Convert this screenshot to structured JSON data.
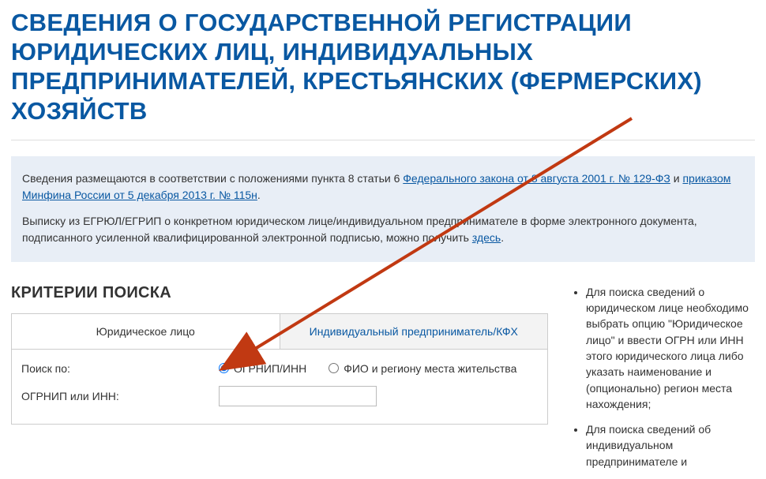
{
  "title": "Сведения о государственной регистрации юридических лиц, индивидуальных предпринимателей, крестьянских (фермерских) хозяйств",
  "info": {
    "p1_prefix": "Сведения размещаются в соответствии с положениями пункта 8 статьи 6 ",
    "link1": "Федерального закона от 8 августа 2001 г. № 129-ФЗ",
    "p1_mid": " и ",
    "link2": "приказом Минфина России от 5 декабря 2013 г. № 115н",
    "p1_suffix": ".",
    "p2_prefix": "Выписку из ЕГРЮЛ/ЕГРИП о конкретном юридическом лице/индивидуальном предпринимателе в форме электронного документа, подписанного усиленной квалифицированной электронной подписью, можно получить ",
    "link3": "здесь",
    "p2_suffix": "."
  },
  "criteria_heading": "Критерии поиска",
  "tabs": {
    "legal": "Юридическое лицо",
    "individual": "Индивидуальный предприниматель/КФХ"
  },
  "form": {
    "search_by_label": "Поиск по:",
    "radio1": "ОГРНИП/ИНН",
    "radio2": "ФИО и региону места жительства",
    "ogrn_label": "ОГРНИП или ИНН:",
    "ogrn_value": ""
  },
  "help": {
    "li1": "Для поиска сведений о юридическом лице необходимо выбрать опцию \"Юридическое лицо\" и ввести ОГРН или ИНН этого юридического лица либо указать наименование и (опционально) регион места нахождения;",
    "li2": "Для поиска сведений об индивидуальном предпринимателе и"
  }
}
